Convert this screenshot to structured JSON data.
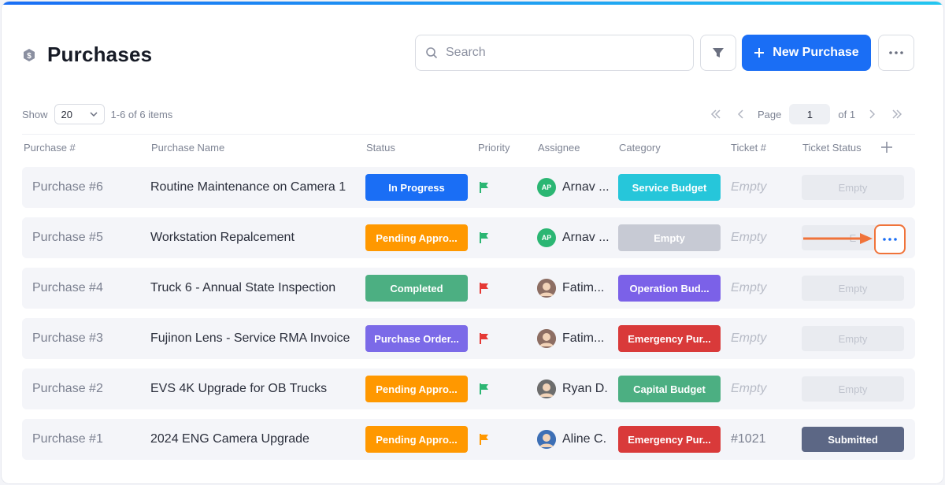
{
  "header": {
    "title": "Purchases",
    "search_placeholder": "Search",
    "new_button_label": "New Purchase"
  },
  "toolbar": {
    "show_label": "Show",
    "page_size": "20",
    "items_summary": "1-6 of 6 items",
    "page_label": "Page",
    "page_value": "1",
    "page_of": "of 1"
  },
  "columns": [
    "Purchase #",
    "Purchase Name",
    "Status",
    "Priority",
    "Assignee",
    "Category",
    "Ticket #",
    "Ticket Status"
  ],
  "rows": [
    {
      "num": "Purchase #6",
      "name": "Routine Maintenance on Camera 1",
      "status": "In Progress",
      "status_color": "#1a6ef5",
      "priority_color": "#2bb673",
      "assignee": "Arnav ...",
      "avatar_initials": "AP",
      "avatar_color": "#2bb673",
      "category": "Service Budget",
      "category_color": "#26c6da",
      "ticket": "Empty",
      "ticket_status": "Empty"
    },
    {
      "num": "Purchase #5",
      "name": "Workstation Repalcement",
      "status": "Pending Appro...",
      "status_color": "#ff9800",
      "priority_color": "#2bb673",
      "assignee": "Arnav ...",
      "avatar_initials": "AP",
      "avatar_color": "#2bb673",
      "category": "Empty",
      "category_color": "#c7cad4",
      "ticket": "Empty",
      "ticket_status": "E"
    },
    {
      "num": "Purchase #4",
      "name": "Truck 6 - Annual State Inspection",
      "status": "Completed",
      "status_color": "#4caf82",
      "priority_color": "#e53935",
      "assignee": "Fatim...",
      "avatar_initials": "",
      "avatar_color": "#8d6e63",
      "category": "Operation Bud...",
      "category_color": "#7b61e8",
      "ticket": "Empty",
      "ticket_status": "Empty"
    },
    {
      "num": "Purchase #3",
      "name": "Fujinon Lens - Service RMA Invoice",
      "status": "Purchase Order...",
      "status_color": "#7b6ae8",
      "priority_color": "#e53935",
      "assignee": "Fatim...",
      "avatar_initials": "",
      "avatar_color": "#8d6e63",
      "category": "Emergency Pur...",
      "category_color": "#d93a3a",
      "ticket": "Empty",
      "ticket_status": "Empty"
    },
    {
      "num": "Purchase #2",
      "name": "EVS 4K Upgrade for OB Trucks",
      "status": "Pending Appro...",
      "status_color": "#ff9800",
      "priority_color": "#2bb673",
      "assignee": "Ryan D.",
      "avatar_initials": "",
      "avatar_color": "#6d6d6d",
      "category": "Capital Budget",
      "category_color": "#4caf82",
      "ticket": "Empty",
      "ticket_status": "Empty"
    },
    {
      "num": "Purchase #1",
      "name": "2024 ENG Camera Upgrade",
      "status": "Pending Appro...",
      "status_color": "#ff9800",
      "priority_color": "#ff9800",
      "assignee": "Aline C.",
      "avatar_initials": "",
      "avatar_color": "#3d6fb5",
      "category": "Emergency Pur...",
      "category_color": "#d93a3a",
      "ticket": "#1021",
      "ticket_status": "Submitted"
    }
  ]
}
